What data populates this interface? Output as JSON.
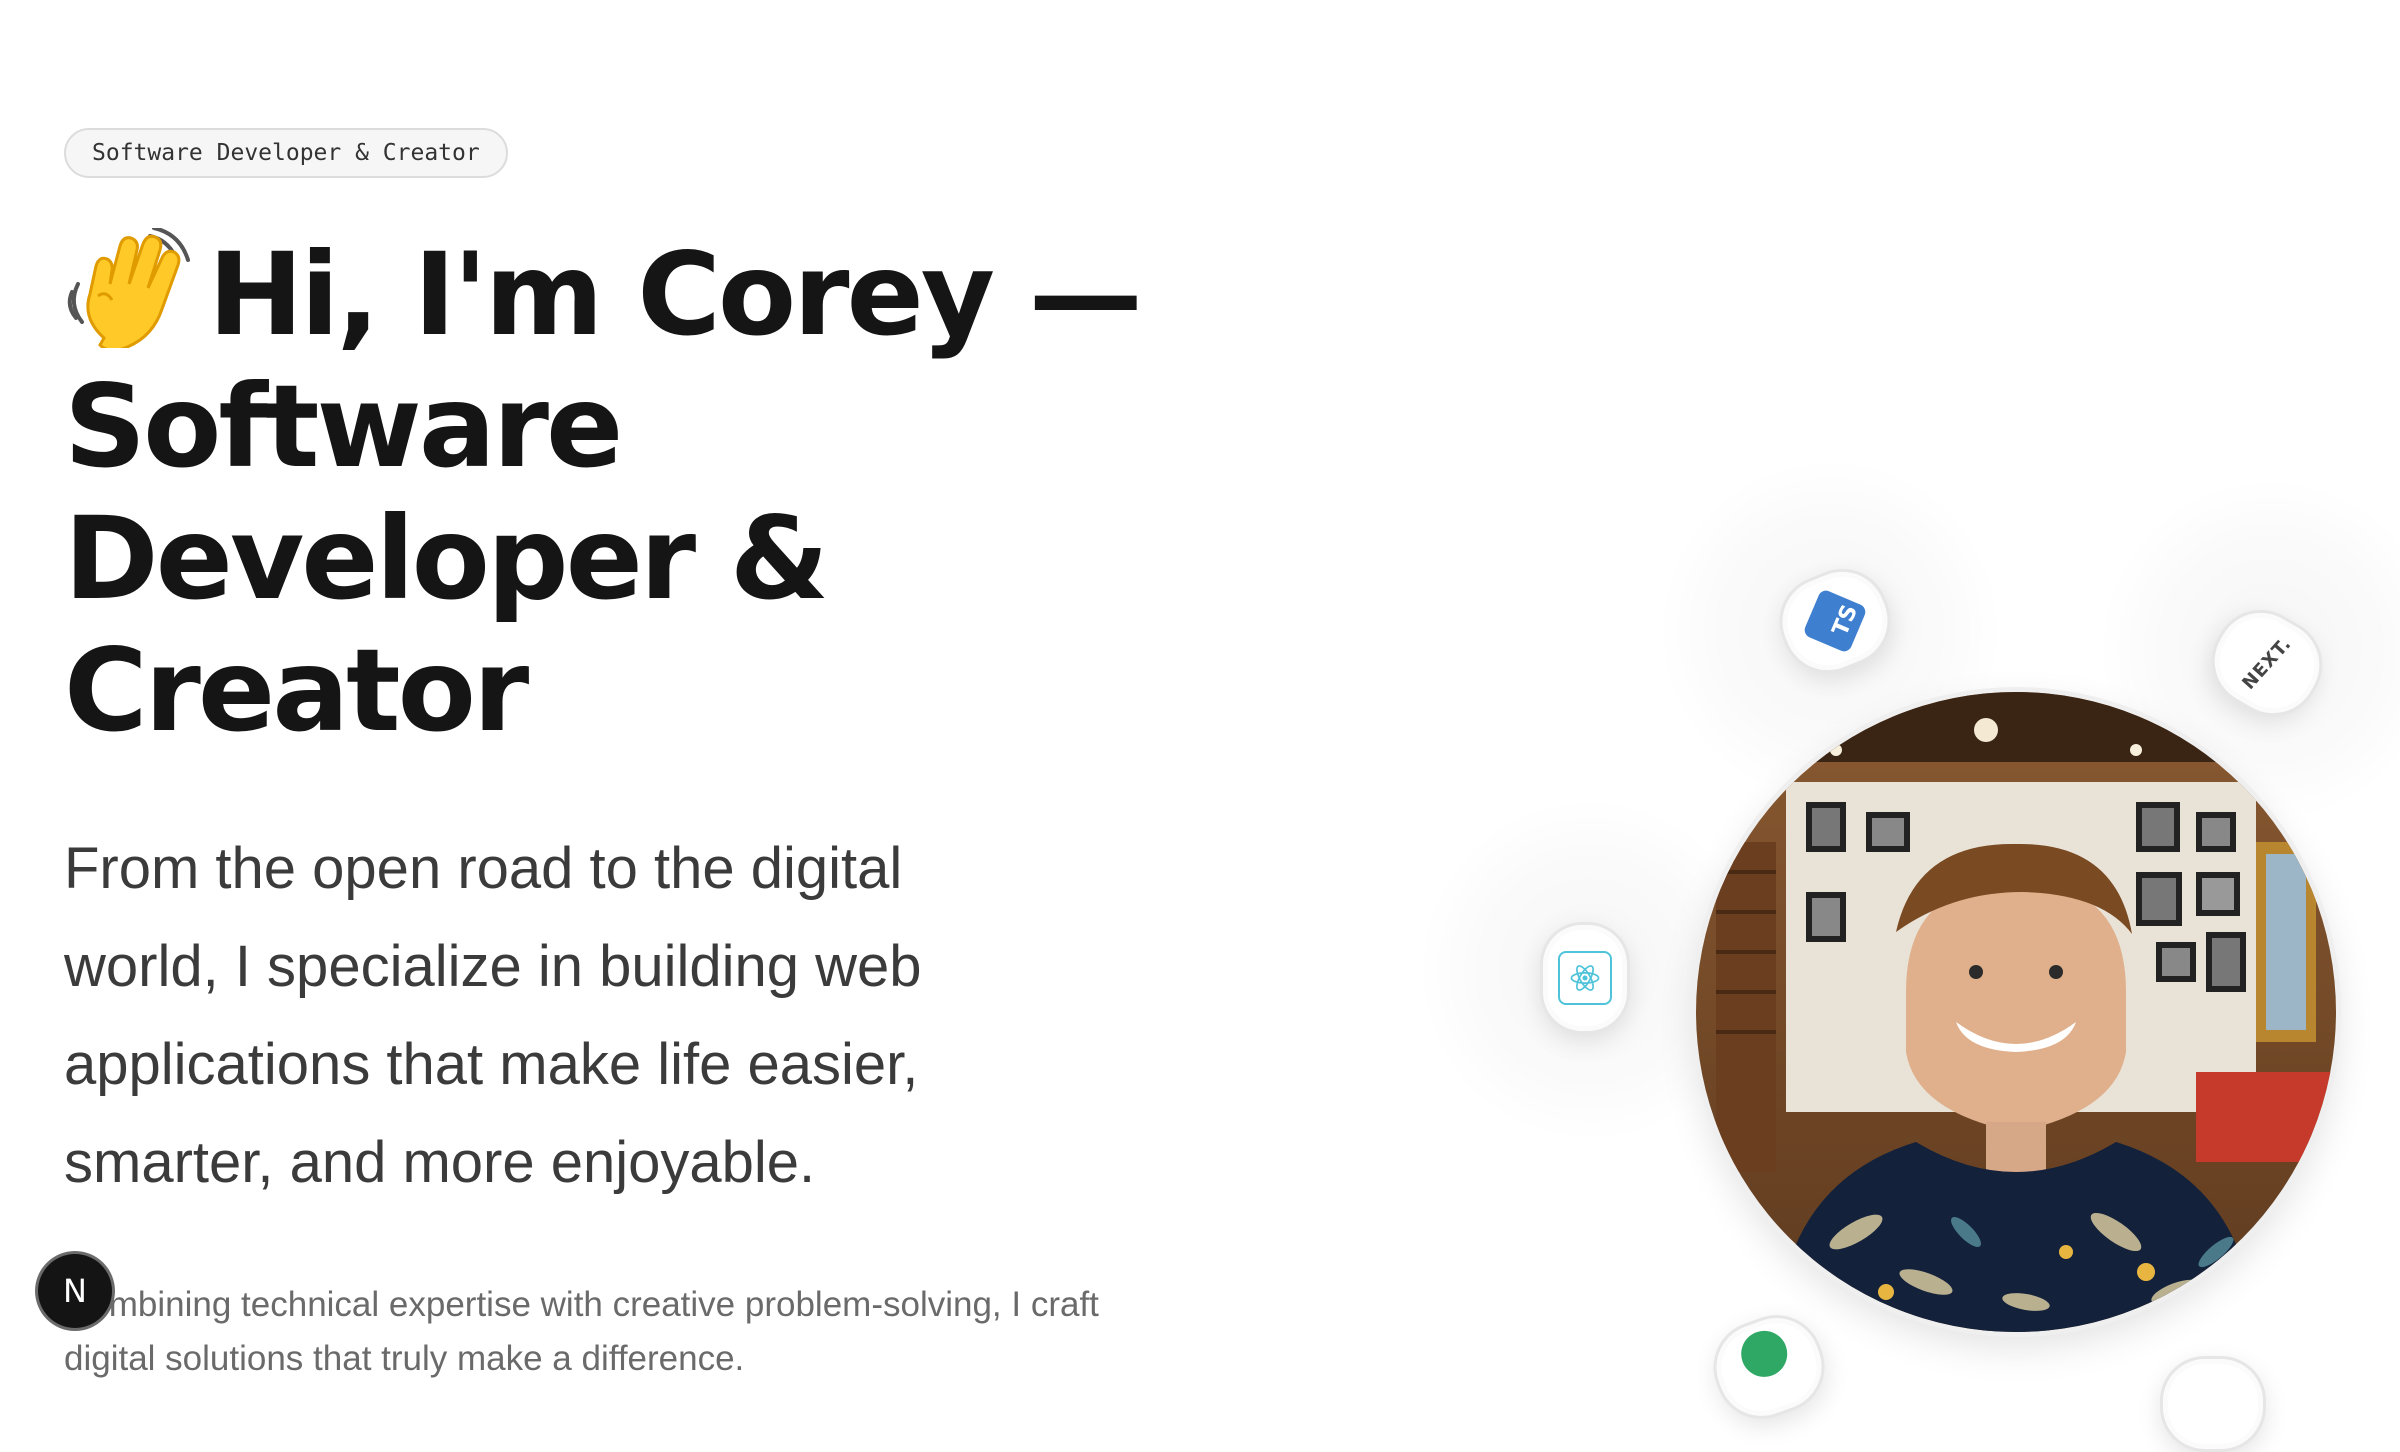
{
  "hero": {
    "tag": "Software Developer & Creator",
    "headline": "Hi, I'm Corey — Software Developer & Creator",
    "intro": "From the open road to the digital world, I specialize in building web applications that make life easier, smarter, and more enjoyable.",
    "subtext": "Combining technical expertise with creative problem-solving, I craft digital solutions that truly make a difference."
  },
  "badge": {
    "letter": "N"
  },
  "icons": {
    "wave": "waving-hand-icon",
    "typescript": "typescript-icon",
    "typescript_label": "TS",
    "nextjs": "nextjs-icon",
    "nextjs_label": "NEXT.",
    "react": "react-icon",
    "partial": "green-tech-icon"
  },
  "colors": {
    "text_primary": "#151515",
    "text_secondary": "#3b3b3b",
    "text_muted": "#6a6a6a",
    "typescript_blue": "#3f7fd0",
    "react_teal": "#4fc3d9"
  }
}
